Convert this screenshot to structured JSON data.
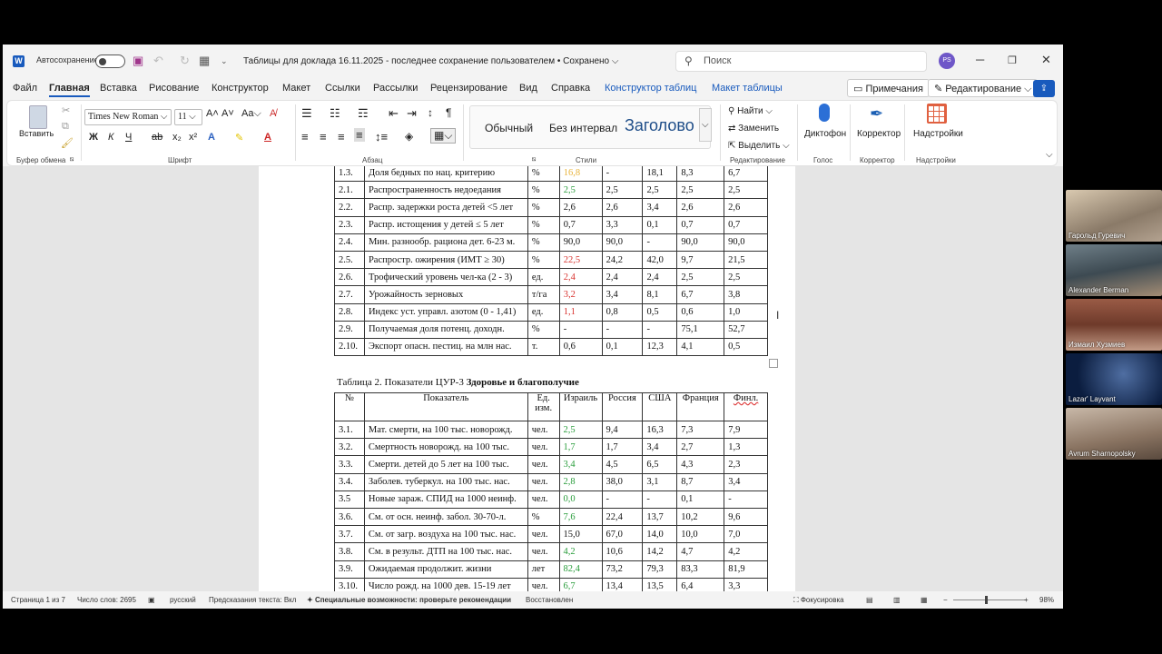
{
  "titlebar": {
    "autosave_label": "Автосохранение",
    "doc_title": "Таблицы для доклада 16.11.2025  -  последнее сохранение пользователем • Сохранено",
    "search_placeholder": "Поиск",
    "avatar_initials": "PS",
    "word_icon": "W"
  },
  "tabs": [
    "Файл",
    "Главная",
    "Вставка",
    "Рисование",
    "Конструктор",
    "Макет",
    "Ссылки",
    "Рассылки",
    "Рецензирование",
    "Вид",
    "Справка",
    "Конструктор таблиц",
    "Макет таблицы"
  ],
  "tab_buttons": {
    "comments": "Примечания",
    "editing": "Редактирование"
  },
  "ribbon": {
    "paste": "Вставить",
    "font_name": "Times New Roman",
    "font_size": "11",
    "styles": [
      "Обычный",
      "Без интервал",
      "Заголово"
    ],
    "find": "Найти",
    "replace": "Заменить",
    "select": "Выделить",
    "dictate": "Диктофон",
    "editor": "Корректор",
    "addins": "Надстройки",
    "groups": {
      "clipboard": "Буфер обмена",
      "font": "Шрифт",
      "paragraph": "Абзац",
      "styles": "Стили",
      "editing": "Редактирование",
      "voice": "Голос",
      "editor": "Корректор",
      "addins": "Надстройки"
    },
    "bold": "Ж",
    "italic": "К",
    "underline": "Ч"
  },
  "table1_rows": [
    [
      "1.3.",
      "Доля бедных по нац. критерию",
      "%",
      "16,8",
      "-",
      "18,1",
      "8,3",
      "6,7"
    ],
    [
      "2.1.",
      "Распространенность недоедания",
      "%",
      "2,5",
      "2,5",
      "2,5",
      "2,5",
      "2,5"
    ],
    [
      "2.2.",
      "Распр. задержки роста детей <5 лет",
      "%",
      "2,6",
      "2,6",
      "3,4",
      "2,6",
      "2,6"
    ],
    [
      "2.3.",
      "Распр. истощения у детей ≤ 5 лет",
      "%",
      "0,7",
      "3,3",
      "0,1",
      "0,7",
      "0,7"
    ],
    [
      "2.4.",
      "Мин. разнообр. рациона дет. 6-23 м.",
      "%",
      "90,0",
      "90,0",
      "-",
      "90,0",
      "90,0"
    ],
    [
      "2.5.",
      "Распростр. ожирения (ИМТ ≥ 30)",
      "%",
      "22,5",
      "24,2",
      "42,0",
      "9,7",
      "21,5"
    ],
    [
      "2.6.",
      "Трофический уровень чел-ка (2 - 3)",
      "ед.",
      "2,4",
      "2,4",
      "2,4",
      "2,5",
      "2,5"
    ],
    [
      "2.7.",
      "Урожайность зерновых",
      "т/га",
      "3,2",
      "3,4",
      "8,1",
      "6,7",
      "3,8"
    ],
    [
      "2.8.",
      "Индекс уст. управл. азотом (0 - 1,41)",
      "ед.",
      "1,1",
      "0,8",
      "0,5",
      "0,6",
      "1,0"
    ],
    [
      "2.9.",
      "Получаемая доля потенц. доходн.",
      "%",
      "-",
      "-",
      "-",
      "75,1",
      "52,7"
    ],
    [
      "2.10.",
      "Экспорт опасн. пестиц. на млн нас.",
      "т.",
      "0,6",
      "0,1",
      "12,3",
      "4,1",
      "0,5"
    ]
  ],
  "table1_colors": [
    "y",
    "g",
    "",
    "",
    "",
    "r",
    "r",
    "r",
    "r",
    "",
    ""
  ],
  "table2_caption_plain": "Таблица 2. Показатели ЦУР-3 ",
  "table2_caption_bold": "Здоровье и благополучие",
  "table2_header": [
    "№",
    "Показатель",
    "Ед. изм.",
    "Израиль",
    "Россия",
    "США",
    "Франция",
    "Финл."
  ],
  "table2_rows": [
    [
      "3.1.",
      "Мат. смерти, на 100 тыс. новорожд.",
      "чел.",
      "2,5",
      "9,4",
      "16,3",
      "7,3",
      "7,9"
    ],
    [
      "3.2.",
      "Смертность новорожд. на 100 тыс.",
      "чел.",
      "1,7",
      "1,7",
      "3,4",
      "2,7",
      "1,3"
    ],
    [
      "3.3.",
      "Смерти. детей до 5 лет на 100 тыс.",
      "чел.",
      "3,4",
      "4,5",
      "6,5",
      "4,3",
      "2,3"
    ],
    [
      "3.4.",
      "Заболев. туберкул. на 100 тыс. нас.",
      "чел.",
      "2,8",
      "38,0",
      "3,1",
      "8,7",
      "3,4"
    ],
    [
      "3.5",
      "Новые зараж. СПИД на 1000 неинф.",
      "чел.",
      "0,0",
      "-",
      "-",
      "0,1",
      "-"
    ],
    [
      "3.6.",
      "См. от осн. неинф. забол. 30-70-л.",
      "%",
      "7,6",
      "22,4",
      "13,7",
      "10,2",
      "9,6"
    ],
    [
      "3.7.",
      "См. от загр. воздуха на 100 тыс. нас.",
      "чел.",
      "15,0",
      "67,0",
      "14,0",
      "10,0",
      "7,0"
    ],
    [
      "3.8.",
      "См. в результ. ДТП на 100 тыс. нас.",
      "чел.",
      "4,2",
      "10,6",
      "14,2",
      "4,7",
      "4,2"
    ],
    [
      "3.9.",
      "Ожидаемая продолжит. жизни",
      "лет",
      "82,4",
      "73,2",
      "79,3",
      "83,3",
      "81,9"
    ],
    [
      "3.10.",
      "Число рожд. на 1000 дев. 15-19 лет",
      "чел.",
      "6,7",
      "13,4",
      "13,5",
      "6,4",
      "3,3"
    ]
  ],
  "table2_colors": [
    "g",
    "g",
    "g",
    "g",
    "g",
    "g",
    "",
    "g",
    "g",
    "g"
  ],
  "status": {
    "page": "Страница 1 из 7",
    "words": "Число слов: 2695",
    "lang": "русский",
    "predict": "Предсказания текста: Вкл",
    "access": "Специальные возможности: проверьте рекомендации",
    "restored": "Восстановлен",
    "focus": "Фокусировка",
    "zoom": "98%"
  },
  "participants": [
    "Гарольд Гуревич",
    "Alexander Berman",
    "Измаил Хузмиев",
    "Lazar' Layvant",
    "Avrum Sharnopolsky"
  ]
}
